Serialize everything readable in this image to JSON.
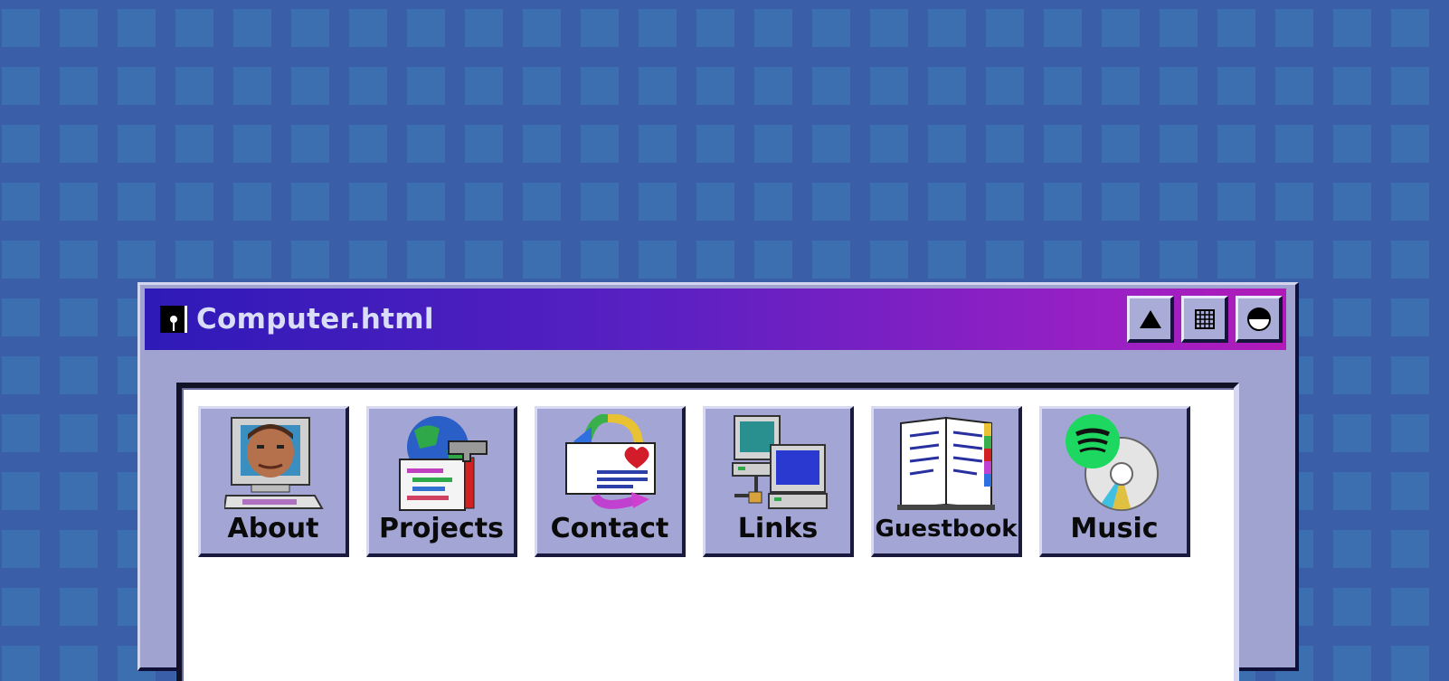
{
  "window": {
    "title": "Computer.html",
    "icon": "floppy-disk-icon",
    "controls": [
      {
        "name": "minimize-button",
        "icon": "triangle-up-icon"
      },
      {
        "name": "grid-button",
        "icon": "grid-icon"
      },
      {
        "name": "theme-button",
        "icon": "half-circle-icon"
      }
    ]
  },
  "apps": [
    {
      "label": "About",
      "icon": "computer-face-icon"
    },
    {
      "label": "Projects",
      "icon": "globe-hammer-icon"
    },
    {
      "label": "Contact",
      "icon": "mail-heart-icon"
    },
    {
      "label": "Links",
      "icon": "network-computers-icon"
    },
    {
      "label": "Guestbook",
      "icon": "open-book-icon"
    },
    {
      "label": "Music",
      "icon": "spotify-cd-icon"
    }
  ],
  "colors": {
    "desktop": "#3c6fb0",
    "title_start": "#2e1ab8",
    "title_end": "#b21ab8",
    "window": "#a0a3cf"
  }
}
